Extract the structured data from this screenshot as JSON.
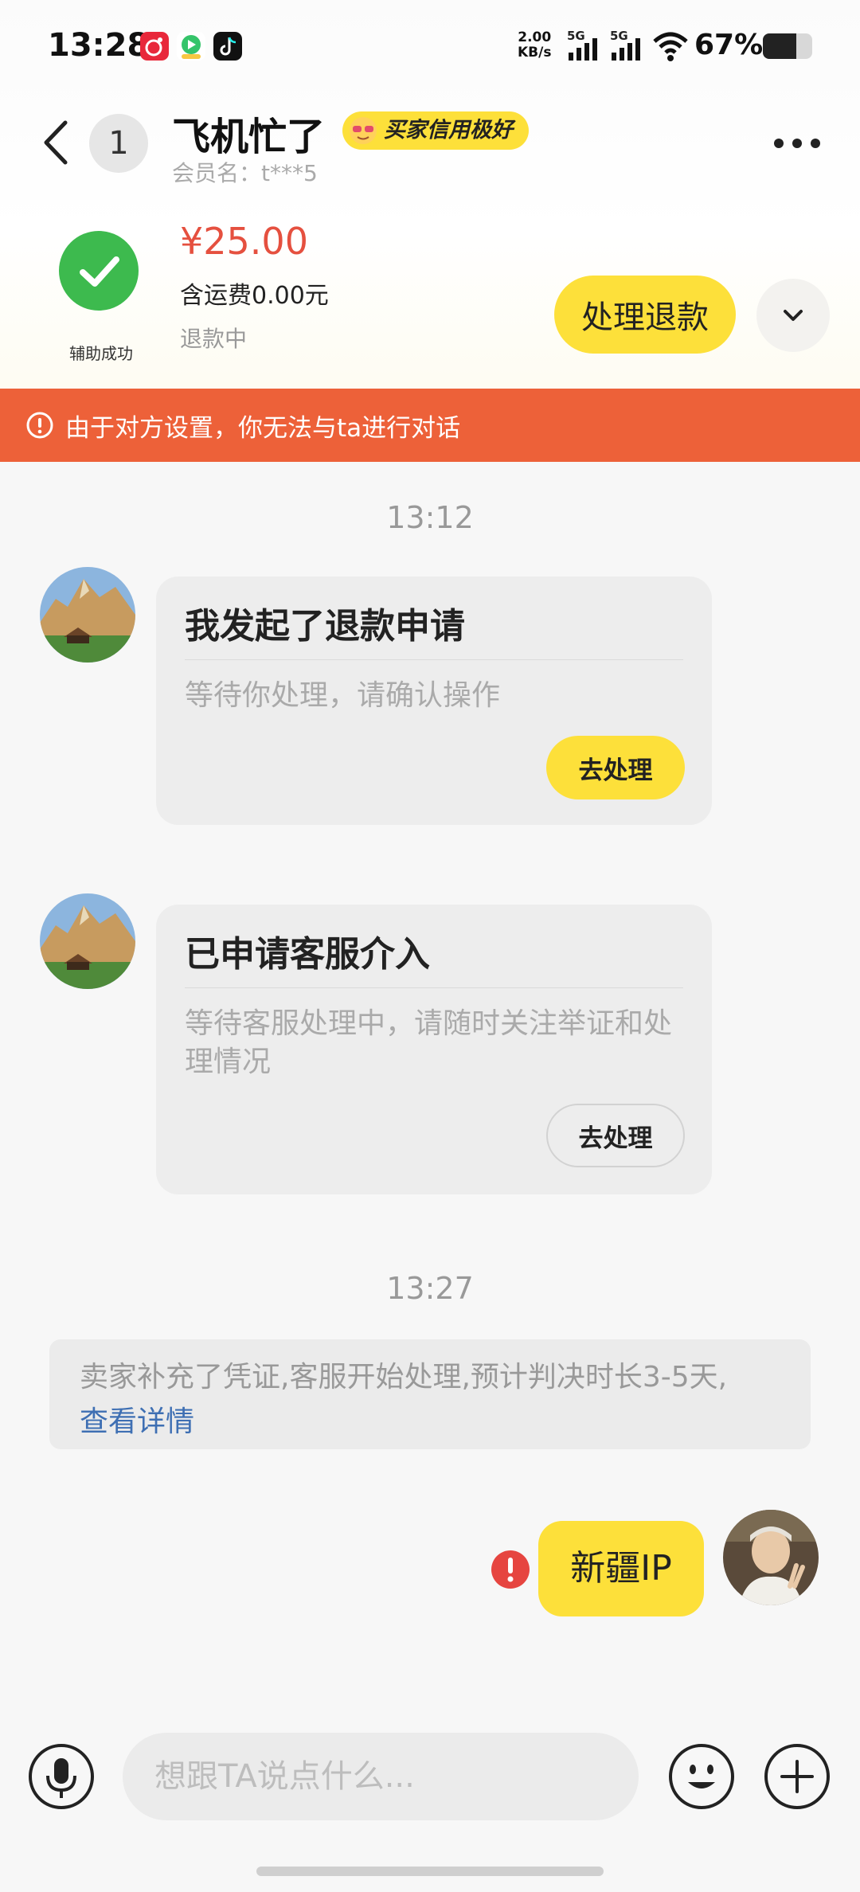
{
  "status_bar": {
    "time": "13:28",
    "net_speed_value": "2.00",
    "net_speed_unit": "KB/s",
    "signal_1": "5G",
    "signal_2": "5G",
    "battery": "67%",
    "battery_level": 0.67
  },
  "header": {
    "unread_count": "1",
    "chat_name": "飞机忙了",
    "credit_tag": "买家信用极好",
    "member_label": "会员名：t***5"
  },
  "order": {
    "assist_label": "辅助成功",
    "price": "¥25.00",
    "shipping": "含运费0.00元",
    "status": "退款中",
    "refund_button": "处理退款"
  },
  "warning": {
    "text": "由于对方设置，你无法与ta进行对话"
  },
  "messages": {
    "time_1": "13:12",
    "card_1": {
      "title": "我发起了退款申请",
      "desc": "等待你处理，请确认操作",
      "button": "去处理"
    },
    "card_2": {
      "title": "已申请客服介入",
      "desc": "等待客服处理中，请随时关注举证和处理情况",
      "button": "去处理"
    },
    "time_2": "13:27",
    "notice": {
      "text": "卖家补充了凭证,客服开始处理,预计判决时长3-5天,",
      "link": "查看详情"
    },
    "my_message": "新疆IP"
  },
  "input": {
    "placeholder": "想跟TA说点什么..."
  },
  "colors": {
    "accent_yellow": "#fde03a",
    "warning_orange": "#ed6139",
    "price_red": "#e5503f",
    "link_blue": "#3e6fb3",
    "success_green": "#3dba4e"
  }
}
